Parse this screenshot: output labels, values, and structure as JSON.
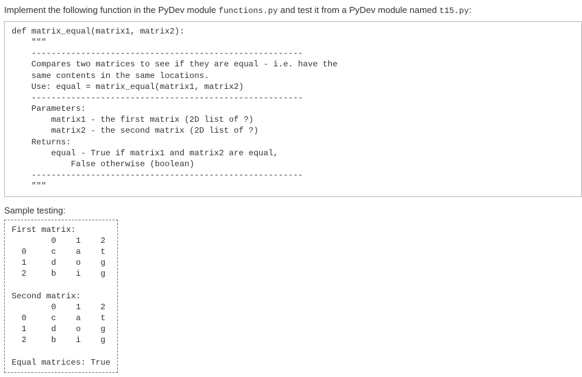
{
  "instruction": {
    "prefix": "Implement the following function in the PyDev module ",
    "module1": "functions.py",
    "middle": " and test it from a PyDev module named ",
    "module2": "t15.py",
    "suffix": ":"
  },
  "code_block": "def matrix_equal(matrix1, matrix2):\n    \"\"\"\n    -------------------------------------------------------\n    Compares two matrices to see if they are equal - i.e. have the\n    same contents in the same locations.\n    Use: equal = matrix_equal(matrix1, matrix2)\n    -------------------------------------------------------\n    Parameters:\n        matrix1 - the first matrix (2D list of ?)\n        matrix2 - the second matrix (2D list of ?)\n    Returns:\n        equal - True if matrix1 and matrix2 are equal,\n            False otherwise (boolean)\n    -------------------------------------------------------\n    \"\"\"",
  "sample_label": "Sample testing:",
  "sample_output": "First matrix:\n        0    1    2\n  0     c    a    t\n  1     d    o    g\n  2     b    i    g\n\nSecond matrix:\n        0    1    2\n  0     c    a    t\n  1     d    o    g\n  2     b    i    g\n\nEqual matrices: True"
}
